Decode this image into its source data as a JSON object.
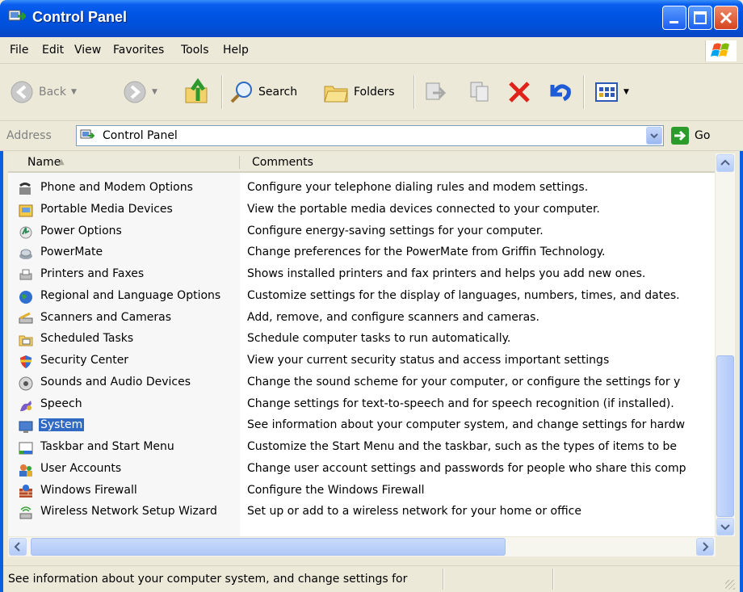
{
  "window": {
    "title": "Control Panel"
  },
  "menu": [
    {
      "label": "File",
      "key": "F"
    },
    {
      "label": "Edit",
      "key": "E"
    },
    {
      "label": "View",
      "key": "V"
    },
    {
      "label": "Favorites",
      "key": "a"
    },
    {
      "label": "Tools",
      "key": "T"
    },
    {
      "label": "Help",
      "key": "H"
    }
  ],
  "toolbar": {
    "back_label": "Back",
    "search_label": "Search",
    "folders_label": "Folders"
  },
  "address": {
    "label": "Address",
    "value": "Control Panel",
    "go_label": "Go"
  },
  "columns": {
    "name": "Name",
    "comments": "Comments"
  },
  "items": [
    {
      "name": "Phone and Modem Options",
      "comment": "Configure your telephone dialing rules and modem settings.",
      "icon": "phone-modem-icon"
    },
    {
      "name": "Portable Media Devices",
      "comment": "View the portable media devices connected to your computer.",
      "icon": "portable-media-icon"
    },
    {
      "name": "Power Options",
      "comment": "Configure energy-saving settings for your computer.",
      "icon": "power-options-icon"
    },
    {
      "name": "PowerMate",
      "comment": "Change preferences for the PowerMate from Griffin Technology.",
      "icon": "powermate-icon"
    },
    {
      "name": "Printers and Faxes",
      "comment": "Shows installed printers and fax printers and helps you add new ones.",
      "icon": "printer-icon"
    },
    {
      "name": "Regional and Language Options",
      "comment": "Customize settings for the display of languages, numbers, times, and dates.",
      "icon": "globe-icon"
    },
    {
      "name": "Scanners and Cameras",
      "comment": "Add, remove, and configure scanners and cameras.",
      "icon": "scanner-icon"
    },
    {
      "name": "Scheduled Tasks",
      "comment": "Schedule computer tasks to run automatically.",
      "icon": "scheduled-tasks-icon"
    },
    {
      "name": "Security Center",
      "comment": "View your current security status and access important settings",
      "icon": "shield-icon"
    },
    {
      "name": "Sounds and Audio Devices",
      "comment": "Change the sound scheme for your computer, or configure the settings for y",
      "icon": "speaker-icon"
    },
    {
      "name": "Speech",
      "comment": "Change settings for text-to-speech and for speech recognition (if installed).",
      "icon": "speech-icon"
    },
    {
      "name": "System",
      "comment": "See information about your computer system, and change settings for hardw",
      "icon": "system-icon",
      "selected": true
    },
    {
      "name": "Taskbar and Start Menu",
      "comment": "Customize the Start Menu and the taskbar, such as the types of items to be",
      "icon": "taskbar-icon"
    },
    {
      "name": "User Accounts",
      "comment": "Change user account settings and passwords for people who share this comp",
      "icon": "user-accounts-icon"
    },
    {
      "name": "Windows Firewall",
      "comment": "Configure the Windows Firewall",
      "icon": "firewall-icon"
    },
    {
      "name": "Wireless Network Setup Wizard",
      "comment": "Set up or add to a wireless network for your home or office",
      "icon": "wireless-icon"
    }
  ],
  "status": {
    "text": "See information about your computer system, and change settings for"
  },
  "colors": {
    "title_blue": "#0054e3",
    "selection": "#316ac5",
    "chrome": "#ece9d8"
  }
}
